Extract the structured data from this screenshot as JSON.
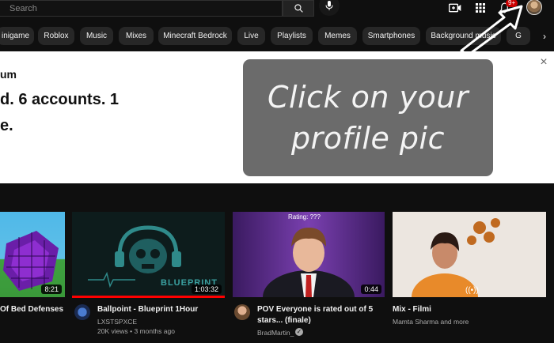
{
  "search": {
    "placeholder": "Search"
  },
  "header": {
    "notification_count": "9+"
  },
  "chips": [
    "inigame",
    "Roblox",
    "Music",
    "Mixes",
    "Minecraft Bedrock",
    "Live",
    "Playlists",
    "Memes",
    "Smartphones",
    "Background music",
    "G"
  ],
  "banner": {
    "line1": "um",
    "line2": "d. 6 accounts. 1",
    "line3": "e."
  },
  "callout": {
    "line1": "Click on your",
    "line2": "profile pic"
  },
  "videos": [
    {
      "title": "Of Bed Defenses",
      "channel": "",
      "stats": "",
      "duration": "8:21"
    },
    {
      "title": "Ballpoint - Blueprint 1Hour",
      "channel": "LXSTSPXCE",
      "stats": "20K views • 3 months ago",
      "duration": "1:03:32",
      "thumb_text": "BLUEPRINT"
    },
    {
      "title": "POV Everyone is rated out of 5 stars... (finale)",
      "channel": "BradMartin_",
      "stats": "",
      "duration": "0:44",
      "thumb_text": "Rating: ???"
    },
    {
      "title": "Mix - Filmi",
      "channel": "Mamta Sharma and more",
      "stats": "",
      "duration": ""
    }
  ],
  "colors": {
    "page_bg": "#0f0f0f",
    "chip_bg": "#272727",
    "callout_bg": "#6b6b6b",
    "badge_red": "#cc0000"
  }
}
